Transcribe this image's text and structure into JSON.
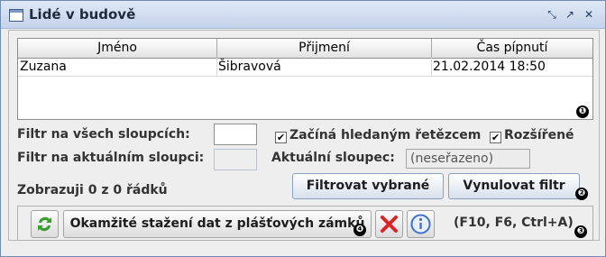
{
  "window": {
    "title": "Lidé v budově",
    "controls": [
      "minimize-icon",
      "maximize-icon",
      "close-icon"
    ]
  },
  "table": {
    "columns": [
      "Jméno",
      "Přijmení",
      "Čas pípnutí"
    ],
    "rows": [
      [
        "Zuzana",
        "Šibravová",
        "21.02.2014 18:50"
      ]
    ],
    "badge": "❶"
  },
  "filters": {
    "all_columns_label": "Filtr na všech sloupcích:",
    "all_columns_value": "",
    "current_column_label": "Filtr na aktuálním sloupci:",
    "current_column_value": "",
    "starts_with_label": "Začíná hledaným řetězcem",
    "starts_with_checked": true,
    "extended_label": "Rozšířené",
    "extended_checked": true,
    "current_column_text_label": "Aktuální sloupec:",
    "current_column_combo": "(neseřazeno)"
  },
  "status": {
    "shown_rows": "Zobrazuji 0 z 0 řádků"
  },
  "buttons": {
    "filter_selected": "Filtrovat vybrané",
    "reset_filter": "Vynulovat filtr",
    "badge": "❷"
  },
  "toolbar": {
    "download_label": "Okamžité stažení dat z plášťových zámků",
    "download_badge": "❹",
    "shortcut_hint": "(F10, F6, Ctrl+A)",
    "badge": "❸",
    "icons": [
      "refresh-icon",
      "delete-icon",
      "info-icon"
    ]
  },
  "colors": {
    "accent": "#6f8cb5",
    "delete": "#d7262b",
    "refresh": "#3b9d2f",
    "info": "#3f73c8"
  }
}
